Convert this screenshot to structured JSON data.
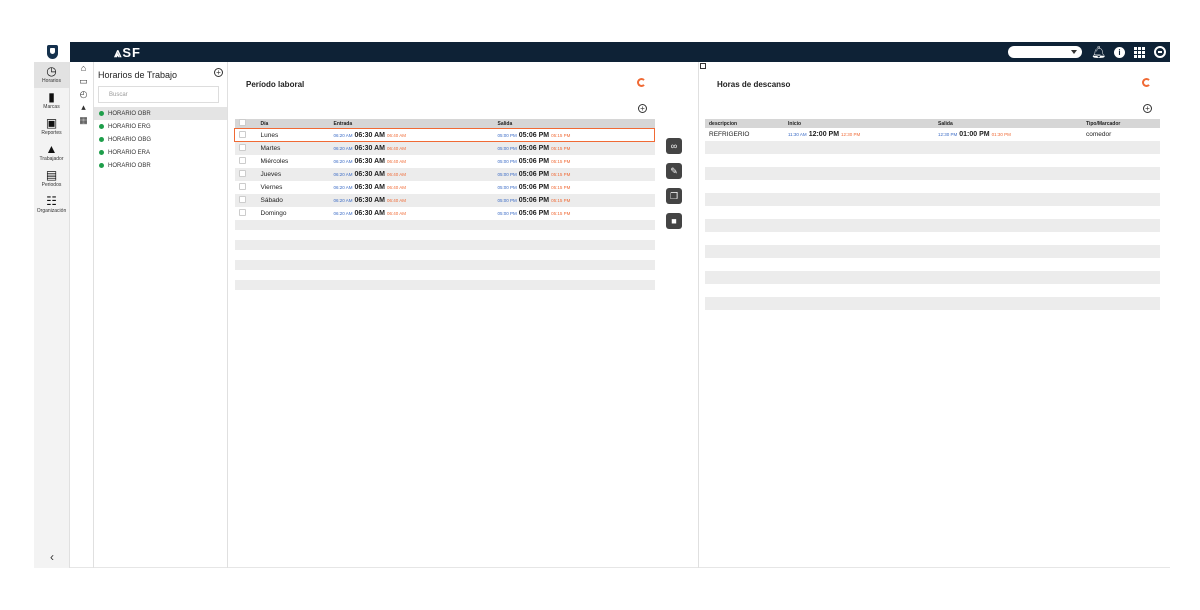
{
  "topbar": {
    "logo": "⩓SF",
    "icons": [
      "shield-icon",
      "chevron-down-icon",
      "bell-icon",
      "info-icon",
      "grid-icon",
      "user-icon"
    ]
  },
  "nav": {
    "items": [
      {
        "label": "Horarios",
        "icon": "clock-plus-icon"
      },
      {
        "label": "Marcas",
        "icon": "bookmark-icon"
      },
      {
        "label": "Reportes",
        "icon": "report-icon"
      },
      {
        "label": "Trabajador",
        "icon": "person-icon"
      },
      {
        "label": "Periodos",
        "icon": "calendar-icon"
      },
      {
        "label": "Organización",
        "icon": "org-icon"
      }
    ],
    "collapse": "‹"
  },
  "list_panel": {
    "title": "Horarios de Trabajo",
    "search_placeholder": "Buscar",
    "items": [
      "HORARIO OBR",
      "HORARIO ERG",
      "HORARIO OBG",
      "HORARIO ERA",
      "HORARIO OBR"
    ]
  },
  "periodo": {
    "title": "Período laboral",
    "columns": [
      "Día",
      "Entrada",
      "Salida"
    ],
    "rows": [
      {
        "day": "Lunes",
        "in_before": "06:20 AM",
        "in": "06:30 AM",
        "in_after": "06:40 AM",
        "out_before": "05:00 PM",
        "out": "05:06 PM",
        "out_after": "05:15 PM"
      },
      {
        "day": "Martes",
        "in_before": "06:20 AM",
        "in": "06:30 AM",
        "in_after": "06:40 AM",
        "out_before": "05:00 PM",
        "out": "05:06 PM",
        "out_after": "05:15 PM"
      },
      {
        "day": "Miércoles",
        "in_before": "06:20 AM",
        "in": "06:30 AM",
        "in_after": "06:40 AM",
        "out_before": "05:00 PM",
        "out": "05:06 PM",
        "out_after": "05:15 PM"
      },
      {
        "day": "Jueves",
        "in_before": "06:20 AM",
        "in": "06:30 AM",
        "in_after": "06:40 AM",
        "out_before": "05:00 PM",
        "out": "05:06 PM",
        "out_after": "05:15 PM"
      },
      {
        "day": "Viernes",
        "in_before": "06:20 AM",
        "in": "06:30 AM",
        "in_after": "06:40 AM",
        "out_before": "05:00 PM",
        "out": "05:06 PM",
        "out_after": "05:15 PM"
      },
      {
        "day": "Sábado",
        "in_before": "06:20 AM",
        "in": "06:30 AM",
        "in_after": "06:40 AM",
        "out_before": "05:00 PM",
        "out": "05:06 PM",
        "out_after": "05:15 PM"
      },
      {
        "day": "Domingo",
        "in_before": "06:20 AM",
        "in": "06:30 AM",
        "in_after": "06:40 AM",
        "out_before": "05:00 PM",
        "out": "05:06 PM",
        "out_after": "05:15 PM"
      }
    ]
  },
  "actions": [
    "link-icon",
    "edit-icon",
    "copy-icon",
    "trash-icon"
  ],
  "descanso": {
    "title": "Horas de descanso",
    "columns": [
      "descripcion",
      "Inicio",
      "Salida",
      "Tipo/Marcador"
    ],
    "rows": [
      {
        "desc": "REFRIGERIO",
        "start_before": "11:30 AM",
        "start": "12:00 PM",
        "start_after": "12:30 PM",
        "end_before": "12:30 PM",
        "end": "01:00 PM",
        "end_after": "01:30 PM",
        "type": "comedor"
      }
    ]
  }
}
